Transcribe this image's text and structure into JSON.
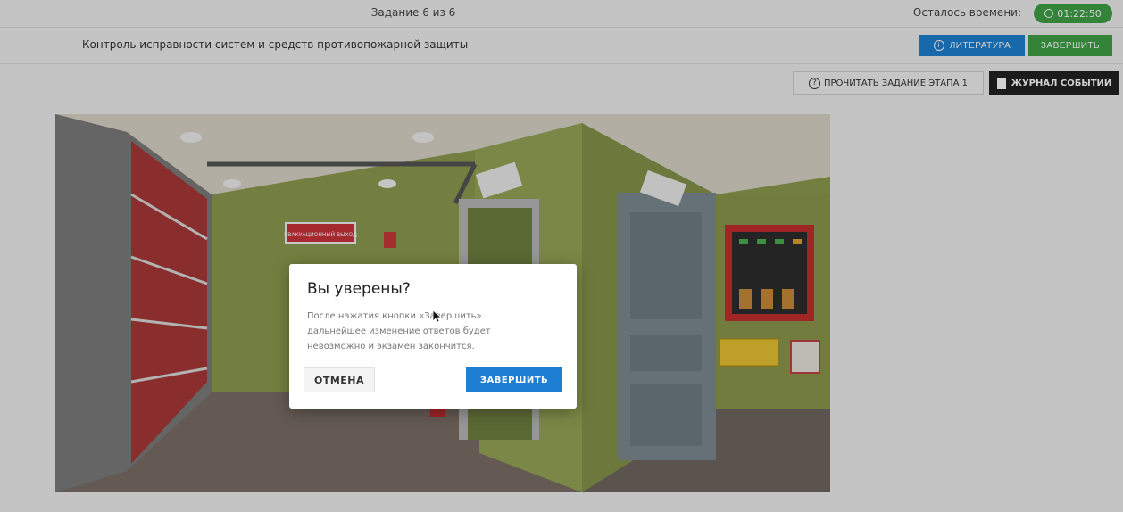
{
  "header": {
    "task_counter": "Задание 6 из 6",
    "time_label": "Осталось времени:",
    "timer": "01:22:50"
  },
  "subheader": {
    "title": "Контроль исправности систем и средств противопожарной защиты",
    "literature_button": "ЛИТЕРАТУРА",
    "finish_button": "ЗАВЕРШИТЬ"
  },
  "toolbar": {
    "read_task_button": "ПРОЧИТАТЬ ЗАДАНИЕ ЭТАПА 1",
    "event_log_button": "ЖУРНАЛ СОБЫТИЙ"
  },
  "scene": {
    "exit_sign": "ЭВАКУАЦИОННЫЙ ВЫХОД"
  },
  "dialog": {
    "title": "Вы уверены?",
    "message": "После нажатия кнопки «Завершить» дальнейшее изменение ответов будет невозможно и экзамен закончится.",
    "cancel_label": "ОТМЕНА",
    "confirm_label": "ЗАВЕРШИТЬ"
  },
  "colors": {
    "primary_blue": "#1e7fd2",
    "success_green": "#3fa046",
    "wall_green": "#8d9b4f",
    "log_button_dark": "#222222"
  }
}
